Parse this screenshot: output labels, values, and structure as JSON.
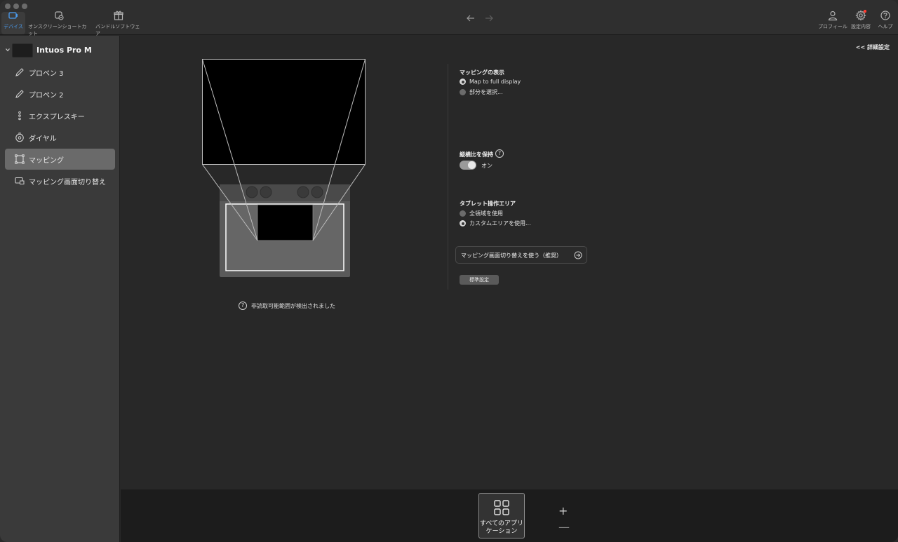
{
  "toolbar": {
    "items": [
      {
        "label": "デバイス",
        "icon": "device-icon",
        "active": true
      },
      {
        "label": "オンスクリーンショートカット",
        "icon": "onscreen-shortcut-icon"
      },
      {
        "label": "バンドルソフトウェア",
        "icon": "gift-icon"
      }
    ],
    "right_items": [
      {
        "label": "プロフィール",
        "icon": "profile-icon"
      },
      {
        "label": "設定内容",
        "icon": "settings-gear-icon"
      },
      {
        "label": "ヘルプ",
        "icon": "help-icon"
      }
    ],
    "accent_color": "#4a9df2",
    "notification_dot_color": "#ff3b30"
  },
  "sidebar": {
    "device_name": "Intuos Pro M",
    "items": [
      {
        "label": "プロペン 3",
        "icon": "pen-icon"
      },
      {
        "label": "プロペン 2",
        "icon": "pen-icon"
      },
      {
        "label": "エクスプレスキー",
        "icon": "expresskey-icon"
      },
      {
        "label": "ダイヤル",
        "icon": "dial-icon"
      },
      {
        "label": "マッピング",
        "icon": "mapping-icon",
        "active": true
      },
      {
        "label": "マッピング画面切り替え",
        "icon": "display-toggle-icon"
      }
    ]
  },
  "main": {
    "advanced_link": "<< 詳細設定",
    "warning": "非読取可能範囲が検出されました",
    "mapping_display": {
      "title": "マッピングの表示",
      "options": [
        "Map to full display",
        "部分を選択..."
      ],
      "selected": 0
    },
    "aspect_ratio": {
      "title": "縦横比を保持",
      "toggle_label": "オン",
      "on": true
    },
    "tablet_area": {
      "title": "タブレット操作エリア",
      "options": [
        "全領域を使用",
        "カスタムエリアを使用..."
      ],
      "selected": 1
    },
    "switch_button": "マッピング画面切り替えを使う（推奨）",
    "default_button": "標準設定"
  },
  "appbar": {
    "all_apps_label": "すべてのアプリケーション",
    "add": "+",
    "remove": "—"
  }
}
